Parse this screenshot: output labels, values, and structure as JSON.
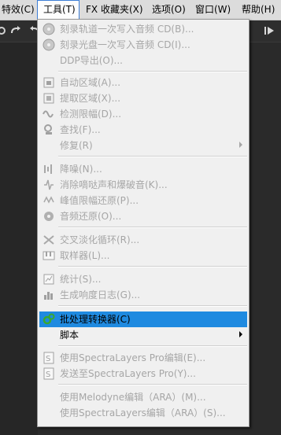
{
  "menubar": {
    "items": [
      {
        "label": "特效(C)"
      },
      {
        "label": "工具(T)"
      },
      {
        "label": "FX 收藏夹(X)"
      },
      {
        "label": "选项(O)"
      },
      {
        "label": "窗口(W)"
      },
      {
        "label": "帮助(H)"
      }
    ]
  },
  "tools_menu": {
    "items": [
      {
        "label": "刻录轨道一次写入音频 CD(B)...",
        "icon": "cd-burn-track-icon",
        "enabled": false
      },
      {
        "label": "刻录光盘一次写入音频 CD(I)...",
        "icon": "cd-burn-disc-icon",
        "enabled": false
      },
      {
        "label": "DDP导出(O)...",
        "icon": "",
        "enabled": false
      },
      {
        "label": "自动区域(A)...",
        "icon": "auto-region-icon",
        "enabled": false
      },
      {
        "label": "提取区域(X)...",
        "icon": "extract-regions-icon",
        "enabled": false
      },
      {
        "label": "检测限幅(D)...",
        "icon": "detect-clipping-icon",
        "enabled": false
      },
      {
        "label": "查找(F)...",
        "icon": "find-icon",
        "enabled": false
      },
      {
        "label": "修复(R)",
        "icon": "",
        "enabled": false,
        "submenu": true
      },
      {
        "label": "降噪(N)...",
        "icon": "noise-reduction-icon",
        "enabled": false
      },
      {
        "label": "消除嘀哒声和爆破音(K)...",
        "icon": "click-pop-removal-icon",
        "enabled": false
      },
      {
        "label": "峰值限幅还原(P)...",
        "icon": "clipping-restoration-icon",
        "enabled": false
      },
      {
        "label": "音频还原(O)...",
        "icon": "audio-restoration-icon",
        "enabled": false
      },
      {
        "label": "交叉淡化循环(R)...",
        "icon": "crossfade-loop-icon",
        "enabled": false
      },
      {
        "label": "取样器(L)...",
        "icon": "sampler-icon",
        "enabled": false
      },
      {
        "label": "统计(S)...",
        "icon": "statistics-icon",
        "enabled": false
      },
      {
        "label": "生成响度日志(G)...",
        "icon": "loudness-log-icon",
        "enabled": false
      },
      {
        "label": "批处理转换器(C)",
        "icon": "batch-converter-icon",
        "enabled": true,
        "highlighted": true
      },
      {
        "label": "脚本",
        "icon": "",
        "enabled": true,
        "submenu": true
      },
      {
        "label": "使用SpectraLayers Pro编辑(E)...",
        "icon": "spectralayers-edit-icon",
        "enabled": false
      },
      {
        "label": "发送至SpectraLayers Pro(Y)...",
        "icon": "spectralayers-send-icon",
        "enabled": false
      },
      {
        "label": "使用Melodyne编辑（ARA）(M)...",
        "icon": "",
        "enabled": false
      },
      {
        "label": "使用SpectraLayers编辑（ARA）(S)...",
        "icon": "",
        "enabled": false
      }
    ]
  },
  "colors": {
    "highlight": "#1f8ae0",
    "menubar_bg": "#dcdcdc",
    "menu_bg": "#f0f0f0",
    "disabled_text": "#a6a6a6",
    "app_bg": "#2b2b2b"
  }
}
